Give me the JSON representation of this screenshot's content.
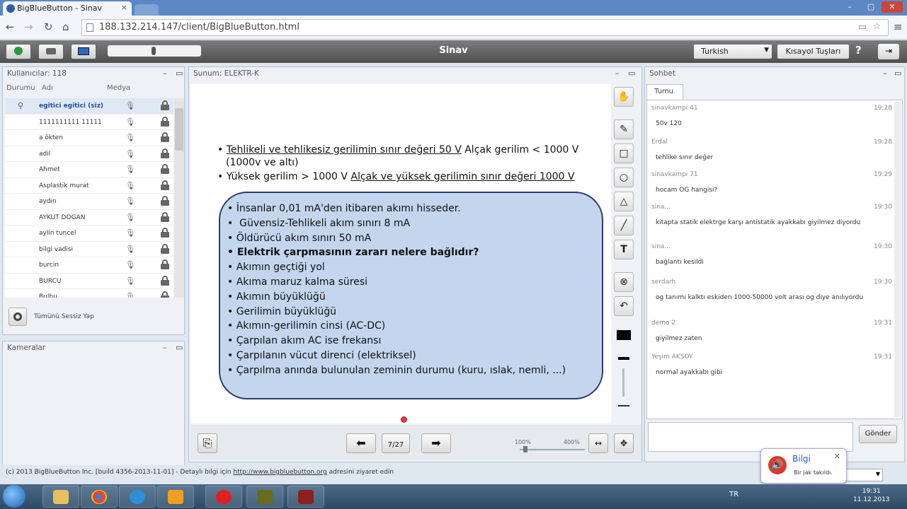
{
  "browser": {
    "tab_title": "BigBlueButton - Sinav",
    "tab_close": "×",
    "url": "188.132.214.147/client/BigBlueButton.html",
    "win_min": "–",
    "win_max": "▢",
    "win_close": "✕"
  },
  "app": {
    "title": "Sinav",
    "language": "Turkish",
    "shortcut_label": "Kısayol Tuşları",
    "help_label": "?"
  },
  "users": {
    "header": "Kullanıcılar: 118",
    "col_status": "Durumu",
    "col_name": "Adı",
    "col_media": "Medya",
    "rows": [
      {
        "name": "egitici egitici (siz)"
      },
      {
        "name": "1111111111 11111"
      },
      {
        "name": "a ökten"
      },
      {
        "name": "adil"
      },
      {
        "name": "Ahmet"
      },
      {
        "name": "Asplastik murat"
      },
      {
        "name": "aydın"
      },
      {
        "name": "AYKUT DOGAN"
      },
      {
        "name": "aylin tuncel"
      },
      {
        "name": "bilgi vadisi"
      },
      {
        "name": "burcin"
      },
      {
        "name": "BURCU"
      },
      {
        "name": "Bulbu"
      }
    ],
    "mute_all": "Tümünü Sessiz Yap"
  },
  "cameras": {
    "header": "Kameralar"
  },
  "presentation": {
    "header": "Sunum: ELEKTR-K",
    "line1_underlined": "Tehlikeli ve tehlikesiz gerilimin sınır değeri 50 V",
    "line1_rest": " Alçak gerilim < 1000 V",
    "line1_cont": "(1000v ve altı)",
    "line2_plain": "Yüksek gerilim > 1000 V ",
    "line2_underlined": "Alçak ve yüksek gerilimin sınır değeri 1000 V",
    "bubble_items": [
      "İnsanlar 0,01 mA'den itibaren akımı hisseder.",
      " Güvensiz-Tehlikeli akım sınırı 8 mA",
      "Öldürücü akım sınırı 50 mA",
      "Elektrik çarpmasının zararı nelere bağlıdır?",
      "Akımın geçtiği yol",
      "Akıma maruz kalma süresi",
      "Akımın büyüklüğü",
      "Gerilimin büyüklüğü",
      "Akımın-gerilimin cinsi (AC-DC)",
      "Çarpılan akım AC ise frekansı",
      "Çarpılanın vücut direnci (elektriksel)",
      "Çarpılma anında bulunulan zeminin durumu (kuru, ıslak, nemli, ...)"
    ],
    "page": "7/27",
    "zoom_min": "100%",
    "zoom_max": "400%"
  },
  "chat": {
    "header": "Sohbet",
    "tab": "Tumu",
    "messages": [
      {
        "sender": "sinavkampi 41",
        "time": "19:28",
        "text": "50v 120"
      },
      {
        "sender": "Erdal",
        "time": "19:28",
        "text": "tehlike sınır değer"
      },
      {
        "sender": "sinavkampi 71",
        "time": "19:29",
        "text": "hocam OG hangisi?"
      },
      {
        "sender": "sina...",
        "time": "19:30",
        "text": "kitapta statik elektrge karşı antistatik ayakkabı giyilmez diyordu"
      },
      {
        "sender": "sina...",
        "time": "19:30",
        "text": "bağlantı kesildi"
      },
      {
        "sender": "serdarh",
        "time": "19:30",
        "text": "og tanımı kalktı eskiden 1000-50000 volt arası og diye anılıyordu"
      },
      {
        "sender": "demo 2",
        "time": "19:31",
        "text": "giyilmez zaten"
      },
      {
        "sender": "Yeşim AKSOY",
        "time": "19:31",
        "text": "normal ayakkabı gibi"
      }
    ],
    "send": "Gönder"
  },
  "footer": {
    "text": "(c) 2013 BigBlueButton Inc. [build 4356-2013-11-01] - Detaylı bilgi için ",
    "link": "http://www.bigbluebutton.org",
    "text2": " adresini ziyaret edin"
  },
  "notification": {
    "title": "Bilgi",
    "body": "Bir jak takıldı.",
    "close": "✕"
  },
  "taskbar": {
    "lang": "TR",
    "time": "19:31",
    "date": "11.12.2013"
  }
}
